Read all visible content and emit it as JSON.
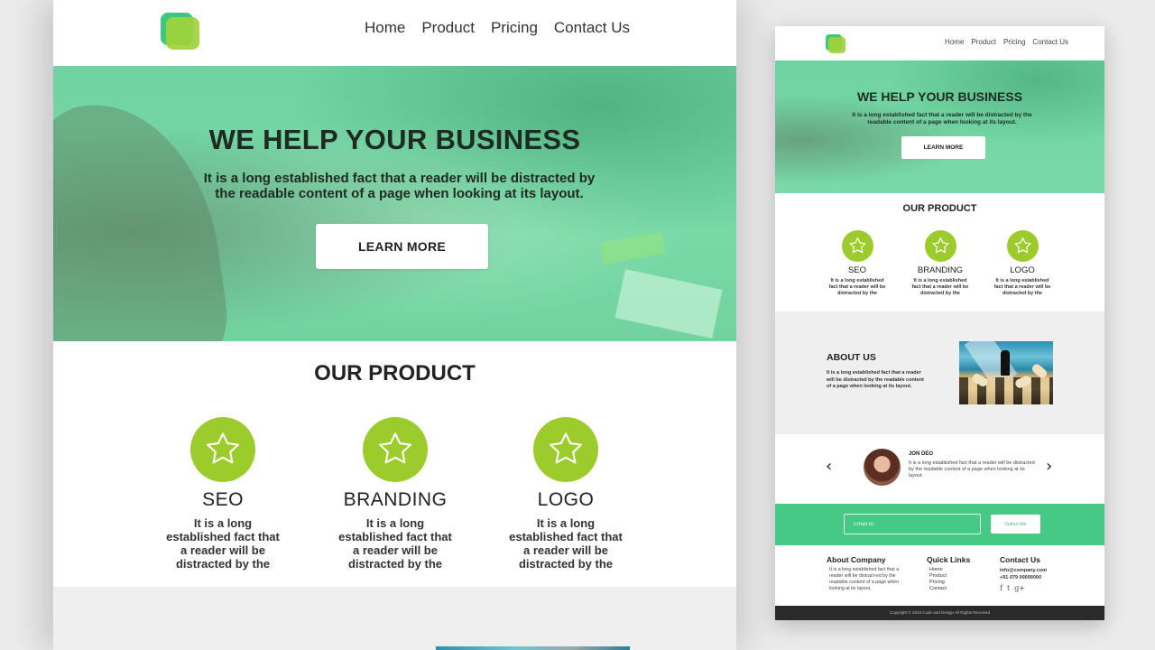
{
  "nav": [
    "Home",
    "Product",
    "Pricing",
    "Contact Us"
  ],
  "hero": {
    "title": "WE HELP YOUR BUSINESS",
    "subtitle": "It is a long established fact that a reader will be distracted by the readable content of a page when looking at its layout.",
    "cta_label": "LEARN MORE"
  },
  "products": {
    "title": "OUR PRODUCT",
    "items": [
      {
        "name": "SEO",
        "icon": "star-icon",
        "desc": "It is a long established fact that a reader will be distracted by the"
      },
      {
        "name": "BRANDING",
        "icon": "star-icon",
        "desc": "It is a long established fact that a reader will be distracted by the"
      },
      {
        "name": "LOGO",
        "icon": "star-icon",
        "desc": "It is a long established fact that a reader will be distracted by the"
      }
    ]
  },
  "about": {
    "title": "ABOUT US",
    "text": "It is a long established fact that a reader will be distracted by the readable content of a page when looking at its layout."
  },
  "testimonial": {
    "name": "JON DEO",
    "quote": "It is a long established fact that a reader will be distracted by the readable content of a page when looking at its layout.",
    "prev_icon": "‹",
    "next_icon": "›"
  },
  "subscribe": {
    "placeholder": "Email ID",
    "button_label": "Subscribe"
  },
  "footer": {
    "about": {
      "title": "About Company",
      "text": "It is a long established fact that a reader will be distract-ed by the readable content of a page when looking at its layout."
    },
    "links": {
      "title": "Quick Links",
      "items": [
        "Home",
        "Product",
        "Pricing",
        "Contact"
      ]
    },
    "contact": {
      "title": "Contact Us",
      "email": "info@company.com",
      "phone": "+91 079 00000000",
      "social": [
        "f",
        "t",
        "g+"
      ]
    },
    "copyright": "Copyright © 2018 Code and Design All Rights Received"
  },
  "colors": {
    "brand_green": "#45c985",
    "accent_lime": "#9ccc2c",
    "footer_dark": "#2a2a2a",
    "section_gray": "#efefef"
  }
}
